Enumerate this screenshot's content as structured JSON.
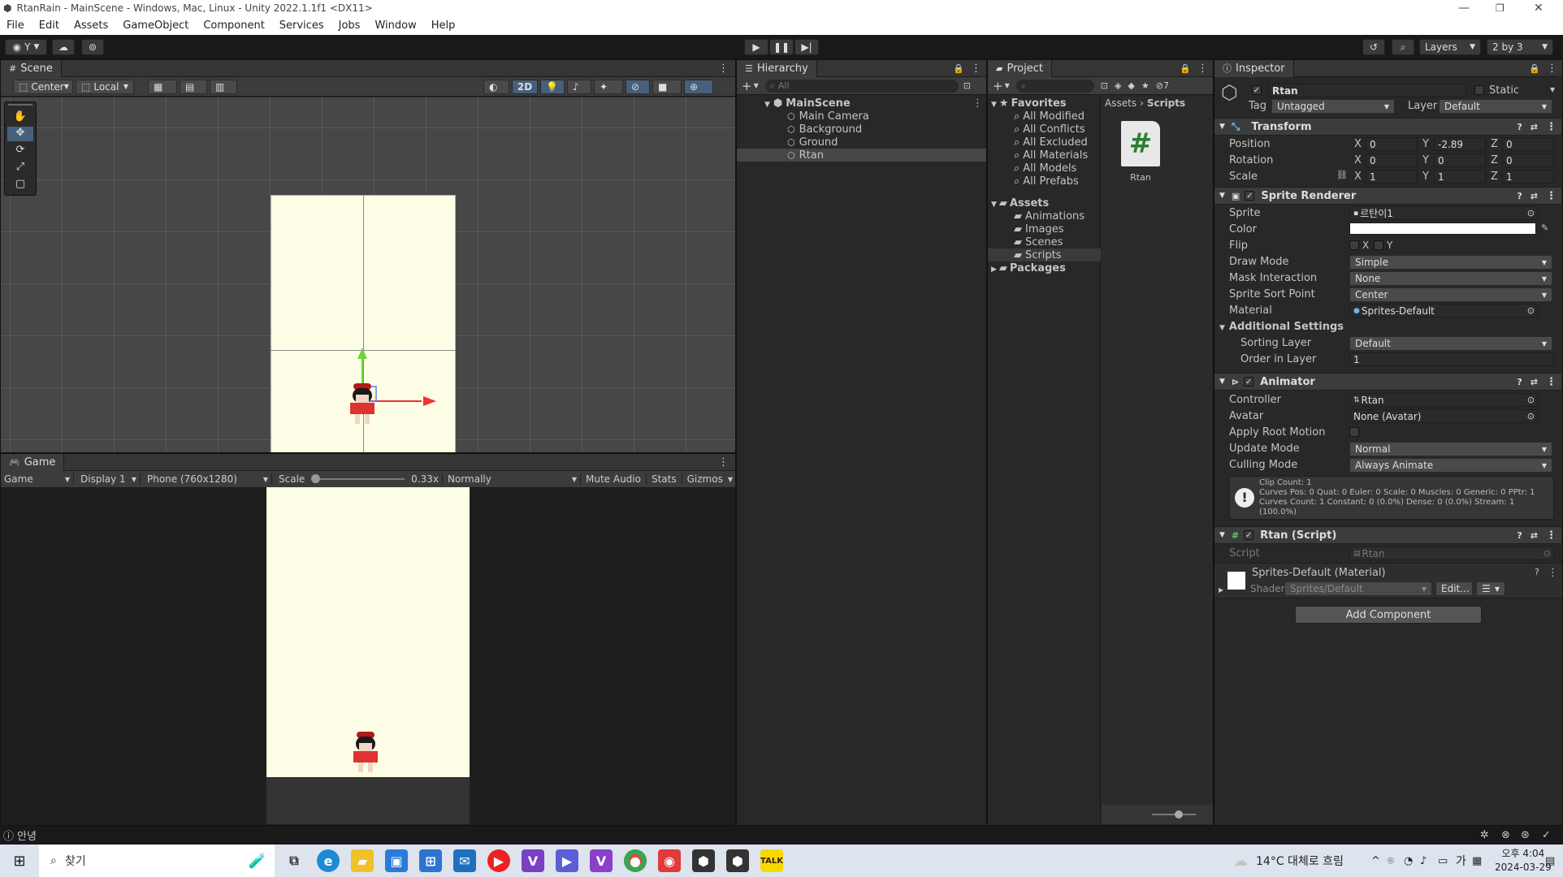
{
  "window": {
    "title": "RtanRain - MainScene - Windows, Mac, Linux - Unity 2022.1.1f1 <DX11>"
  },
  "menu": [
    "File",
    "Edit",
    "Assets",
    "GameObject",
    "Component",
    "Services",
    "Jobs",
    "Window",
    "Help"
  ],
  "toolbar": {
    "account": "Y",
    "layers": "Layers",
    "layout": "2 by 3"
  },
  "scene": {
    "tab": "Scene",
    "pivot": "Center",
    "space": "Local",
    "mode_2d": "2D"
  },
  "game": {
    "tab": "Game",
    "view": "Game",
    "display": "Display 1",
    "resolution": "Phone (760x1280)",
    "scale_label": "Scale",
    "scale_value": "0.33x",
    "play_focus": "Normally",
    "mute": "Mute Audio",
    "stats": "Stats",
    "gizmos": "Gizmos"
  },
  "hierarchy": {
    "tab": "Hierarchy",
    "search_placeholder": "All",
    "scene": "MainScene",
    "items": [
      "Main Camera",
      "Background",
      "Ground",
      "Rtan"
    ],
    "selected": "Rtan"
  },
  "project": {
    "tab": "Project",
    "count": "7",
    "favorites_label": "Favorites",
    "favorites": [
      "All Modified",
      "All Conflicts",
      "All Excluded",
      "All Materials",
      "All Models",
      "All Prefabs"
    ],
    "assets_label": "Assets",
    "asset_folders": [
      "Animations",
      "Images",
      "Scenes",
      "Scripts"
    ],
    "packages_label": "Packages",
    "breadcrumb": [
      "Assets",
      "Scripts"
    ],
    "file_name": "Rtan"
  },
  "inspector": {
    "tab": "Inspector",
    "object_name": "Rtan",
    "static_label": "Static",
    "tag_label": "Tag",
    "tag": "Untagged",
    "layer_label": "Layer",
    "layer": "Default",
    "transform": {
      "header": "Transform",
      "position_label": "Position",
      "position": {
        "x": "0",
        "y": "-2.89",
        "z": "0"
      },
      "rotation_label": "Rotation",
      "rotation": {
        "x": "0",
        "y": "0",
        "z": "0"
      },
      "scale_label": "Scale",
      "scale": {
        "x": "1",
        "y": "1",
        "z": "1"
      }
    },
    "sprite_renderer": {
      "header": "Sprite Renderer",
      "labels": [
        "Sprite",
        "Color",
        "Flip",
        "Draw Mode",
        "Mask Interaction",
        "Sprite Sort Point",
        "Material"
      ],
      "sprite": "르탄이1",
      "flip_x": "X",
      "flip_y": "Y",
      "draw_mode": "Simple",
      "mask_interaction": "None",
      "sort_point": "Center",
      "material": "Sprites-Default",
      "additional": "Additional Settings",
      "sorting_layer_label": "Sorting Layer",
      "sorting_layer": "Default",
      "order_label": "Order in Layer",
      "order": "1"
    },
    "animator": {
      "header": "Animator",
      "labels": [
        "Controller",
        "Avatar",
        "Apply Root Motion",
        "Update Mode",
        "Culling Mode"
      ],
      "controller": "Rtan",
      "avatar": "None (Avatar)",
      "update_mode": "Normal",
      "culling_mode": "Always Animate",
      "info": [
        "Clip Count: 1",
        "Curves Pos: 0 Quat: 0 Euler: 0 Scale: 0 Muscles: 0 Generic: 0 PPtr: 1",
        "Curves Count: 1 Constant: 0 (0.0%) Dense: 0 (0.0%) Stream: 1 (100.0%)"
      ]
    },
    "script": {
      "header": "Rtan (Script)",
      "label": "Script",
      "value": "Rtan"
    },
    "material": {
      "name": "Sprites-Default (Material)",
      "shader_label": "Shader",
      "shader": "Sprites/Default",
      "edit": "Edit..."
    },
    "add_component": "Add Component"
  },
  "status": {
    "text": "안녕"
  },
  "taskbar": {
    "search": "찾기",
    "weather": "14°C  대체로 흐림",
    "ime": "가",
    "time": "오후 4:04",
    "date": "2024-03-29"
  }
}
